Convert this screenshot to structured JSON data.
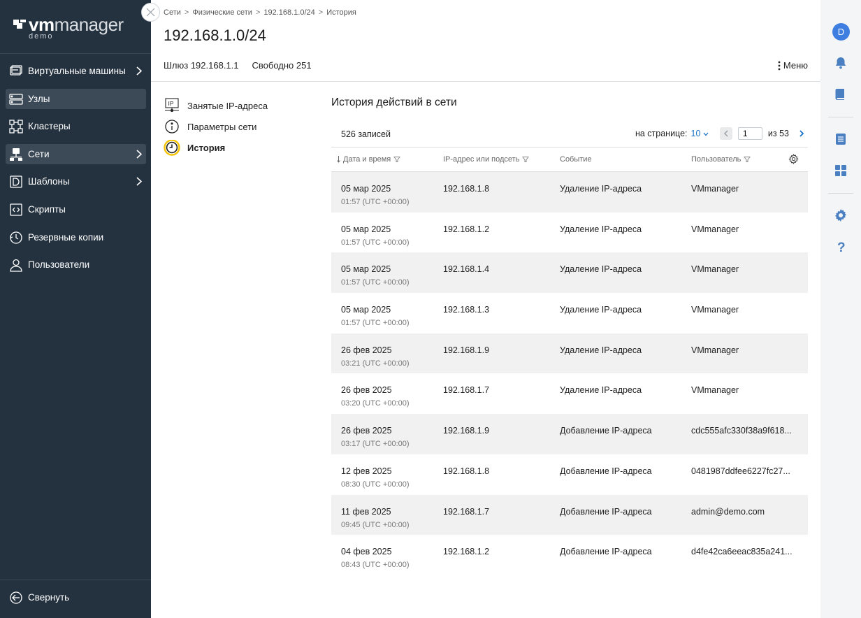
{
  "sidebar": {
    "logo": {
      "vm": "vm",
      "manager": "manager",
      "sub": "demo"
    },
    "items": [
      {
        "label": "Виртуальные машины",
        "icon": "virtual-machine-icon",
        "chevron": true,
        "active": false
      },
      {
        "label": "Узлы",
        "icon": "node-server-icon",
        "chevron": false,
        "active": true
      },
      {
        "label": "Кластеры",
        "icon": "cluster-icon",
        "chevron": false,
        "active": false
      },
      {
        "label": "Сети",
        "icon": "network-icon",
        "chevron": true,
        "active": true
      },
      {
        "label": "Шаблоны",
        "icon": "template-icon",
        "chevron": true,
        "active": false
      },
      {
        "label": "Скрипты",
        "icon": "script-icon",
        "chevron": false,
        "active": false
      },
      {
        "label": "Резервные копии",
        "icon": "backup-icon",
        "chevron": false,
        "active": false
      },
      {
        "label": "Пользователи",
        "icon": "user-icon",
        "chevron": false,
        "active": false
      }
    ],
    "collapse_label": "Свернуть"
  },
  "breadcrumb": [
    "Сети",
    "Физические сети",
    "192.168.1.0/24",
    "История"
  ],
  "page": {
    "title": "192.168.1.0/24",
    "gateway": "Шлюз 192.168.1.1",
    "free": "Свободно 251",
    "menu_label": "Меню"
  },
  "subnav": [
    {
      "label": "Занятые IP-адреса",
      "icon": "ip-address-icon",
      "active": false
    },
    {
      "label": "Параметры сети",
      "icon": "info-icon",
      "active": false
    },
    {
      "label": "История",
      "icon": "clock-icon",
      "active": true
    }
  ],
  "history": {
    "title": "История действий в сети",
    "records": "526 записей",
    "per_page_label": "на странице:",
    "per_page_value": "10",
    "current_page": "1",
    "of_label": "из 53",
    "columns": {
      "date": "Дата и время",
      "ip": "IP-адрес или подсеть",
      "event": "Событие",
      "user": "Пользователь"
    },
    "rows": [
      {
        "date": "05 мар 2025",
        "time": "01:57 (UTC +00:00)",
        "ip": "192.168.1.8",
        "event": "Удаление IP-адреса",
        "user": "VMmanager"
      },
      {
        "date": "05 мар 2025",
        "time": "01:57 (UTC +00:00)",
        "ip": "192.168.1.2",
        "event": "Удаление IP-адреса",
        "user": "VMmanager"
      },
      {
        "date": "05 мар 2025",
        "time": "01:57 (UTC +00:00)",
        "ip": "192.168.1.4",
        "event": "Удаление IP-адреса",
        "user": "VMmanager"
      },
      {
        "date": "05 мар 2025",
        "time": "01:57 (UTC +00:00)",
        "ip": "192.168.1.3",
        "event": "Удаление IP-адреса",
        "user": "VMmanager"
      },
      {
        "date": "26 фев 2025",
        "time": "03:21 (UTC +00:00)",
        "ip": "192.168.1.9",
        "event": "Удаление IP-адреса",
        "user": "VMmanager"
      },
      {
        "date": "26 фев 2025",
        "time": "03:20 (UTC +00:00)",
        "ip": "192.168.1.7",
        "event": "Удаление IP-адреса",
        "user": "VMmanager"
      },
      {
        "date": "26 фев 2025",
        "time": "03:17 (UTC +00:00)",
        "ip": "192.168.1.9",
        "event": "Добавление IP-адреса",
        "user": "cdc555afc330f38a9f618..."
      },
      {
        "date": "12 фев 2025",
        "time": "08:30 (UTC +00:00)",
        "ip": "192.168.1.8",
        "event": "Добавление IP-адреса",
        "user": "0481987ddfee6227fc27..."
      },
      {
        "date": "11 фев 2025",
        "time": "09:45 (UTC +00:00)",
        "ip": "192.168.1.7",
        "event": "Добавление IP-адреса",
        "user": "admin@demo.com"
      },
      {
        "date": "04 фев 2025",
        "time": "08:43 (UTC +00:00)",
        "ip": "192.168.1.2",
        "event": "Добавление IP-адреса",
        "user": "d4fe42ca6eeac835a241..."
      }
    ]
  },
  "rail": {
    "avatar_letter": "D",
    "icons": [
      "bell-icon",
      "book-icon",
      "notes-icon",
      "dashboard-icon",
      "settings-gear-icon",
      "help-icon"
    ]
  },
  "colors": {
    "sidebar_bg": "#243240",
    "active_item_bg": "#3c4a58",
    "accent_blue": "#1a73c9",
    "avatar_blue": "#3d7ee0",
    "history_ring": "#f5c400",
    "row_alt_bg": "#f1f1f1"
  }
}
